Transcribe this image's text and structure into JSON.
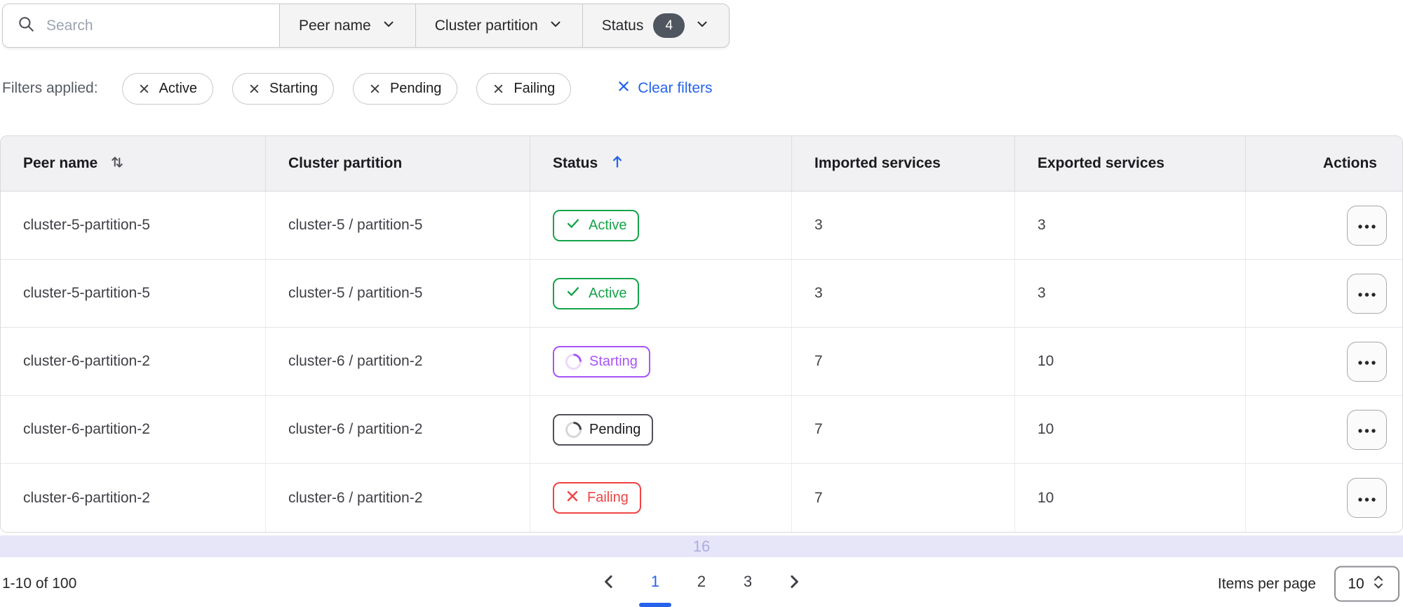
{
  "toolbar": {
    "search": {
      "placeholder": "Search"
    },
    "dropdowns": [
      {
        "label": "Peer name"
      },
      {
        "label": "Cluster partition"
      },
      {
        "label": "Status",
        "badge": "4"
      }
    ]
  },
  "applied_filters": {
    "label": "Filters applied:",
    "chips": [
      "Active",
      "Starting",
      "Pending",
      "Failing"
    ],
    "clear_label": "Clear filters"
  },
  "table": {
    "columns": [
      {
        "label": "Peer name",
        "sort": "sortable"
      },
      {
        "label": "Cluster partition",
        "sort": "none"
      },
      {
        "label": "Status",
        "sort": "ascending"
      },
      {
        "label": "Imported services",
        "sort": "none"
      },
      {
        "label": "Exported services",
        "sort": "none"
      },
      {
        "label": "Actions",
        "sort": "none"
      }
    ],
    "rows": [
      {
        "peer_name": "cluster-5-partition-5",
        "cluster_partition": "cluster-5 / partition-5",
        "status": "Active",
        "imported": "3",
        "exported": "3"
      },
      {
        "peer_name": "cluster-5-partition-5",
        "cluster_partition": "cluster-5 / partition-5",
        "status": "Active",
        "imported": "3",
        "exported": "3"
      },
      {
        "peer_name": "cluster-6-partition-2",
        "cluster_partition": "cluster-6 / partition-2",
        "status": "Starting",
        "imported": "7",
        "exported": "10"
      },
      {
        "peer_name": "cluster-6-partition-2",
        "cluster_partition": "cluster-6 / partition-2",
        "status": "Pending",
        "imported": "7",
        "exported": "10"
      },
      {
        "peer_name": "cluster-6-partition-2",
        "cluster_partition": "cluster-6 / partition-2",
        "status": "Failing",
        "imported": "7",
        "exported": "10"
      }
    ],
    "partial_row_indicator": "16"
  },
  "pagination": {
    "range_label": "1-10 of 100",
    "pages": [
      "1",
      "2",
      "3"
    ],
    "current_page": "1",
    "items_per_page_label": "Items per page",
    "page_size": "10"
  },
  "colors": {
    "accent_blue": "#2563eb",
    "status_active": "#16a34a",
    "status_starting": "#a855f7",
    "status_pending_border": "#52525b",
    "status_failing": "#ef4444",
    "count_badge_bg": "#4f565f",
    "partial_row_bg": "#e7e6f8",
    "partial_row_text": "#aeabe4"
  }
}
